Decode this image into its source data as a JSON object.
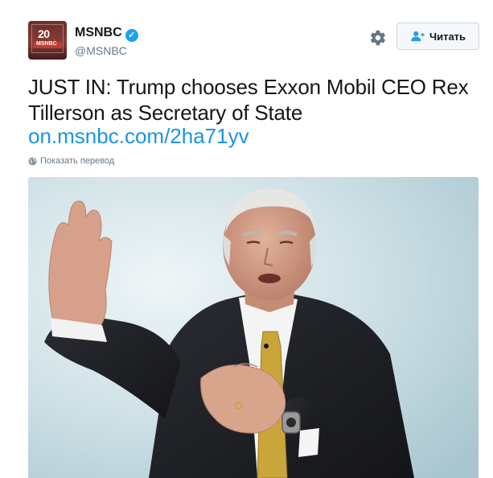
{
  "account": {
    "avatar_badge": "20",
    "avatar_brand": "MSNBC",
    "name": "MSNBC",
    "verified_icon": "verified-badge-icon",
    "handle": "@MSNBC"
  },
  "actions": {
    "settings_icon": "gear-icon",
    "follow_icon": "add-user-icon",
    "follow_label": "Читать"
  },
  "tweet": {
    "text": "JUST IN: Trump chooses Exxon Mobil CEO Rex Tillerson as Secretary of State",
    "link": "on.msnbc.com/2ha71yv",
    "translate_icon": "globe-icon",
    "translate_label": "Показать перевод"
  },
  "media": {
    "type": "photo",
    "colors": {
      "background": "#c9dde4",
      "suit": "#1e1f24",
      "tie": "#c9a53a",
      "skin": "#d9a48c",
      "hair": "#e4e4e0"
    }
  },
  "colors": {
    "link": "#1b95e0",
    "verified": "#1da1f2",
    "muted": "#657786"
  }
}
